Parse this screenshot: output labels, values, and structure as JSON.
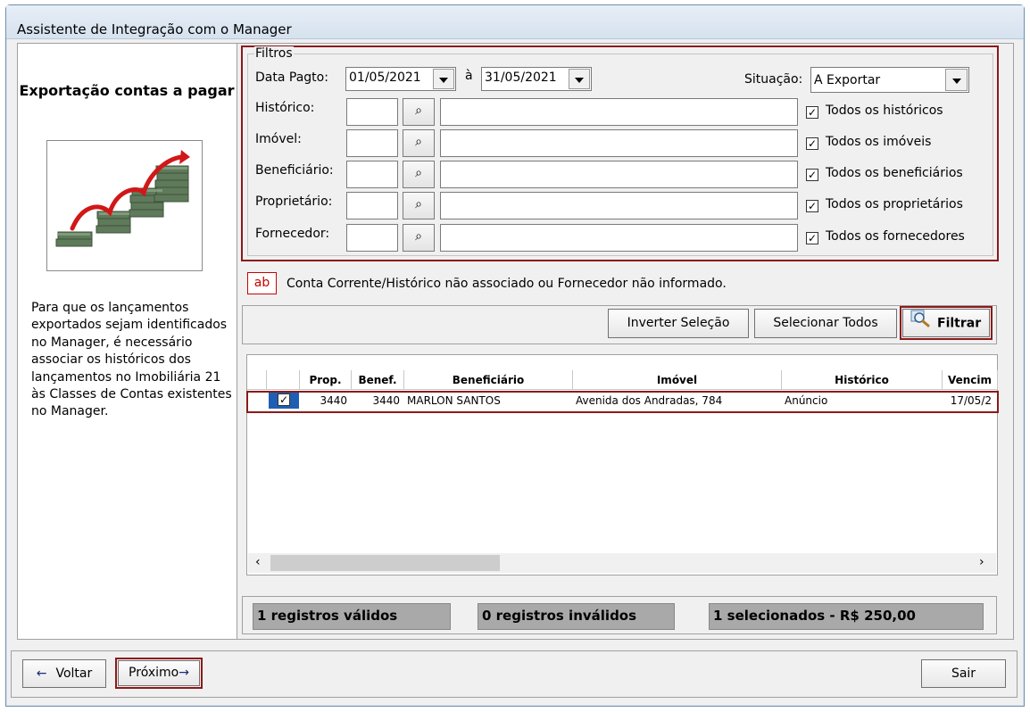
{
  "window": {
    "title": "Assistente de Integração com o Manager"
  },
  "left": {
    "title": "Exportação contas a pagar",
    "description": "Para que os lançamentos exportados sejam identificados no Manager, é necessário associar os históricos dos lançamentos no Imobiliária 21 às Classes de Contas existentes no Manager."
  },
  "filters": {
    "group_label": "Filtros",
    "date_label": "Data Pagto:",
    "date_from": "01/05/2021",
    "date_sep": "à",
    "date_to": "31/05/2021",
    "situacao_label": "Situação:",
    "situacao_value": "A Exportar",
    "rows": [
      {
        "label": "Histórico:",
        "check_label": "Todos os históricos",
        "checked": true
      },
      {
        "label": "Imóvel:",
        "check_label": "Todos os imóveis",
        "checked": true
      },
      {
        "label": "Beneficiário:",
        "check_label": "Todos os beneficiários",
        "checked": true
      },
      {
        "label": "Proprietário:",
        "check_label": "Todos os proprietários",
        "checked": true
      },
      {
        "label": "Fornecedor:",
        "check_label": "Todos os fornecedores",
        "checked": true
      }
    ]
  },
  "legend": {
    "badge": "ab",
    "text": "Conta Corrente/Histórico não associado ou Fornecedor não informado."
  },
  "actions": {
    "invert": "Inverter Seleção",
    "select_all": "Selecionar Todos",
    "filter": "Filtrar"
  },
  "table": {
    "columns": [
      "",
      "Prop.",
      "Benef.",
      "Beneficiário",
      "Imóvel",
      "Histórico",
      "Vencim"
    ],
    "rows": [
      {
        "checked": true,
        "prop": "3440",
        "benef": "3440",
        "beneficiario": "MARLON SANTOS",
        "imovel": "Avenida dos Andradas, 784",
        "historico": "Anúncio",
        "vencimento": "17/05/2"
      }
    ]
  },
  "status": {
    "valid": "1 registros válidos",
    "invalid": "0 registros inválidos",
    "selected": "1 selecionados - R$ 250,00"
  },
  "footer": {
    "back": "Voltar",
    "next": "Próximo",
    "exit": "Sair"
  },
  "colors": {
    "highlight_border": "#8b1a1a",
    "legend_red": "#cc0000",
    "status_bg": "#a9a9a9",
    "check_blue": "#1e5fb4"
  }
}
